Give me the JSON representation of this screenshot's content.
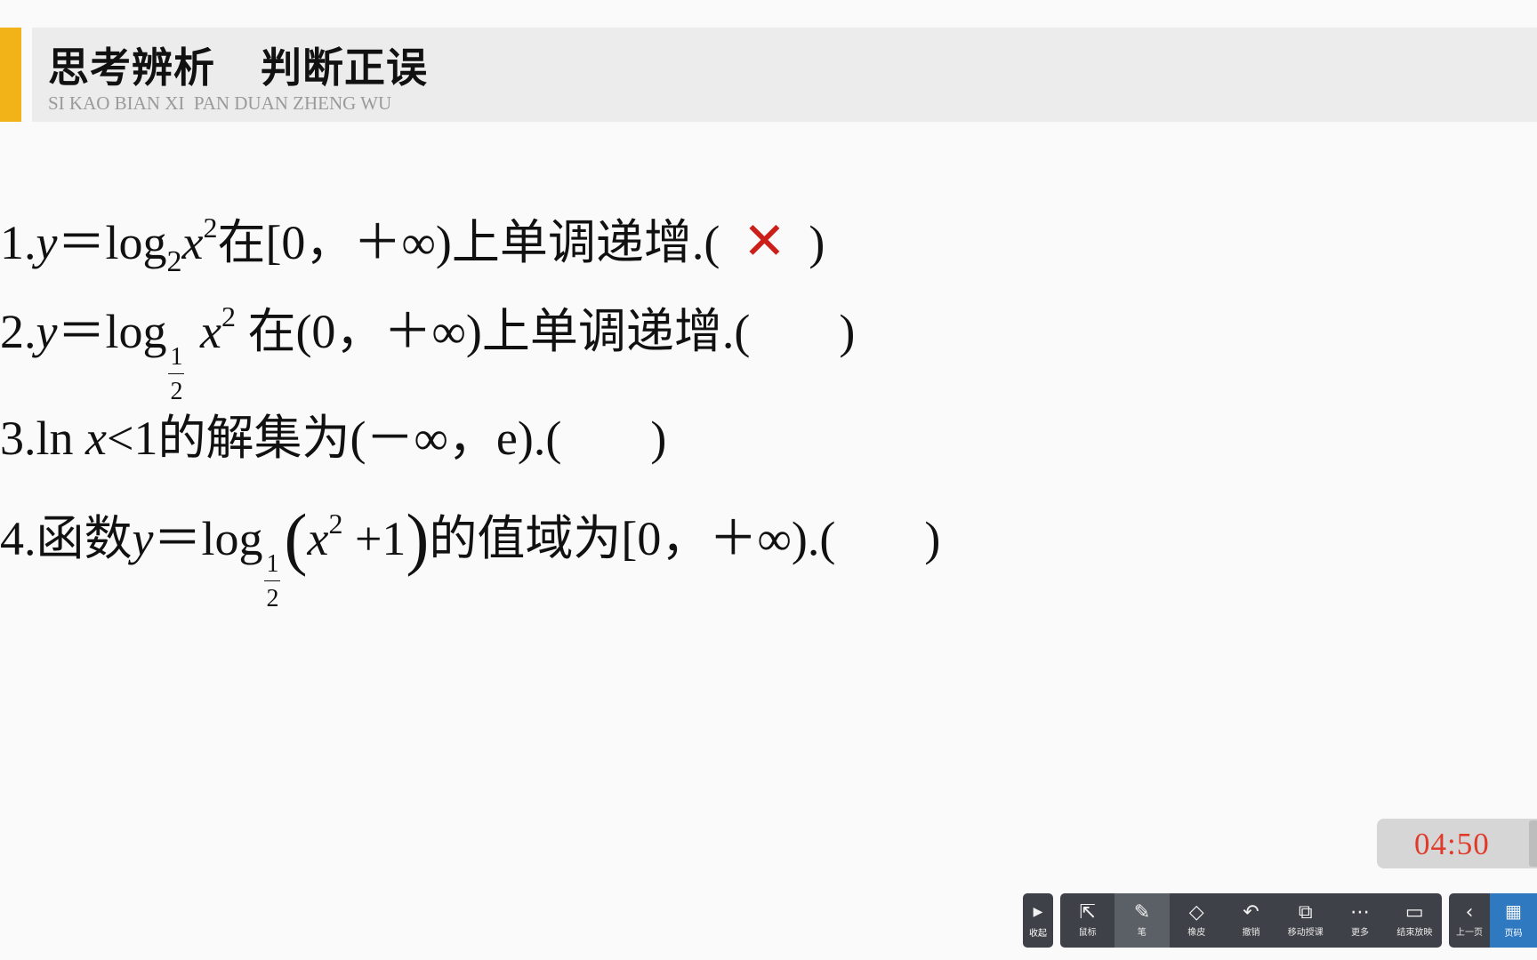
{
  "header": {
    "title": "思考辨析   判断正误",
    "subtitle": "SI KAO BIAN XI  PAN DUAN ZHENG WU"
  },
  "questions": {
    "q1": {
      "num": "1.",
      "y": "y",
      "eq": "＝log",
      "base": "2",
      "x": "x",
      "exp": "2",
      "rest": "在[0，＋∞)上单调递增.(",
      "answer": "✕",
      "close": ")"
    },
    "q2": {
      "num": "2.",
      "y": "y",
      "eq": "＝log",
      "frac_num": "1",
      "frac_den": "2",
      "x": "x",
      "exp": "2",
      "rest": "在(0，＋∞)上单调递增.(",
      "close": ")"
    },
    "q3": {
      "pre": "3.ln ",
      "x": "x",
      "rest": "<1的解集为(－∞，e).(",
      "close": ")"
    },
    "q4": {
      "pre": "4.函数",
      "y": "y",
      "eq": "＝log",
      "frac_num": "1",
      "frac_den": "2",
      "lparen": "(",
      "x": "x",
      "exp": "2",
      "plus": " +1",
      "rparen": ")",
      "rest": "的值域为[0，＋∞).(",
      "close": ")"
    }
  },
  "timer": {
    "value": "04:50"
  },
  "toolbar": {
    "collapse": {
      "icon": "▶",
      "label": "收起"
    },
    "buttons": [
      {
        "icon": "⇱",
        "label": "鼠标"
      },
      {
        "icon": "✎",
        "label": "笔"
      },
      {
        "icon": "◇",
        "label": "橡皮"
      },
      {
        "icon": "↶",
        "label": "撤销"
      },
      {
        "icon": "⧉",
        "label": "移动授课"
      },
      {
        "icon": "⋯",
        "label": "更多"
      },
      {
        "icon": "▭",
        "label": "结束放映"
      }
    ],
    "prev": {
      "icon": "‹",
      "label": "上一页"
    },
    "page": {
      "icon": "▦",
      "label": "页码"
    }
  },
  "colors": {
    "accent": "#f2b318",
    "answer_mark": "#cc1f1a",
    "timer_text": "#e03a2b",
    "toolbar_bg": "#3e4147"
  }
}
